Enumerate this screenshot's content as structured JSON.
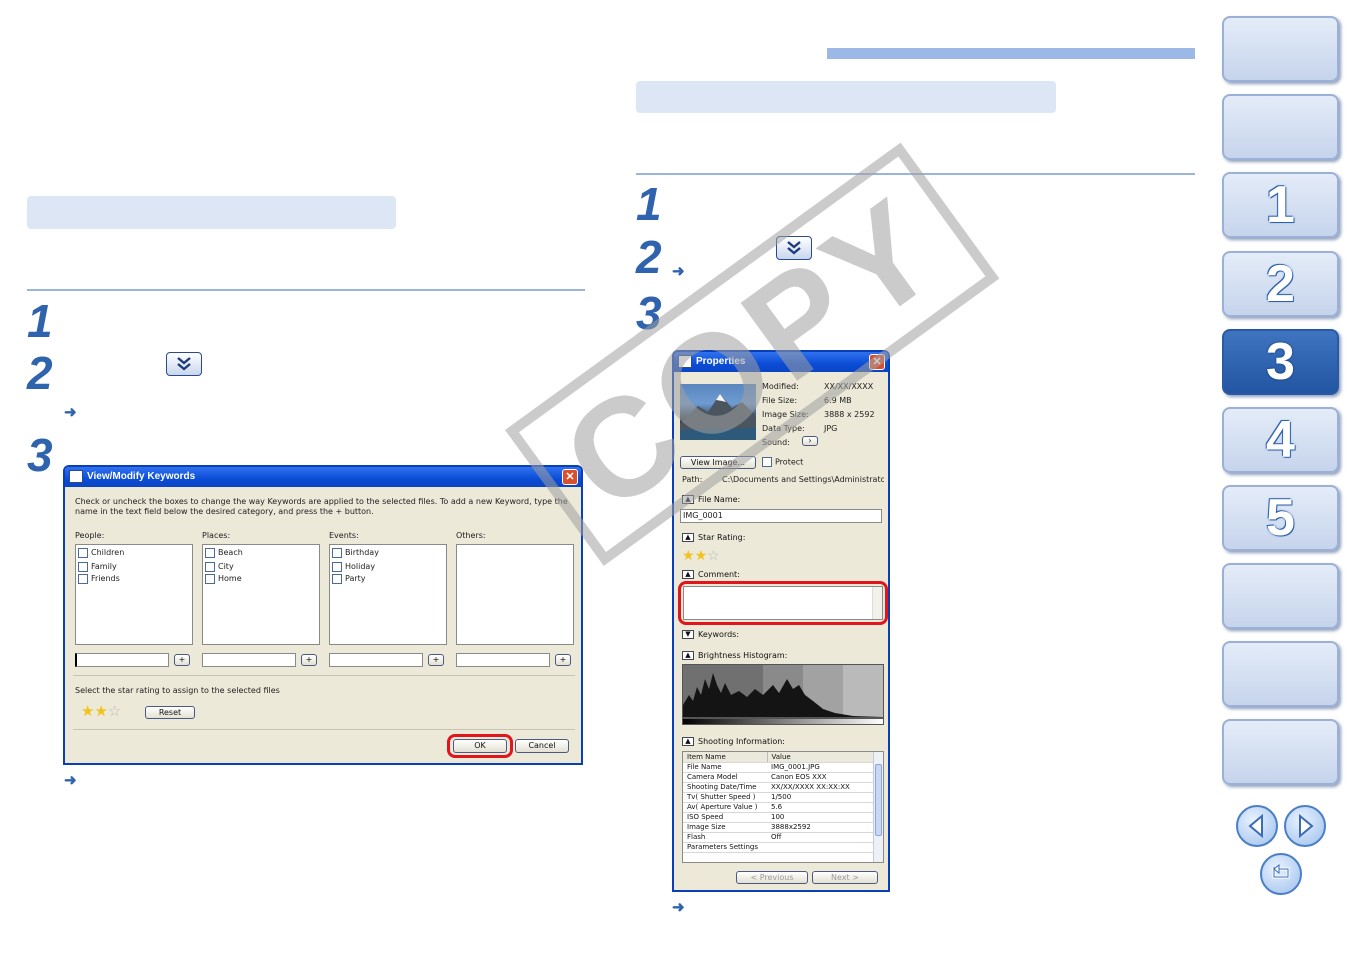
{
  "left_column": {
    "steps": [
      "1",
      "2",
      "3"
    ]
  },
  "right_column": {
    "steps": [
      "1",
      "2",
      "3"
    ]
  },
  "keywords_dialog": {
    "title": "View/Modify Keywords",
    "instruction": "Check or uncheck the boxes to change the way Keywords are applied to the selected files. To add a new Keyword, type the name in the text field below the desired category, and press the + button.",
    "columns": [
      {
        "label": "People:",
        "items": [
          "Children",
          "Family",
          "Friends"
        ]
      },
      {
        "label": "Places:",
        "items": [
          "Beach",
          "City",
          "Home"
        ]
      },
      {
        "label": "Events:",
        "items": [
          "Birthday",
          "Holiday",
          "Party"
        ]
      },
      {
        "label": "Others:",
        "items": []
      }
    ],
    "add_button": "+",
    "star_prompt": "Select the star rating to assign to the selected files",
    "rating": 2,
    "reset_label": "Reset",
    "ok_label": "OK",
    "cancel_label": "Cancel"
  },
  "properties_dialog": {
    "title": "Properties",
    "info": [
      {
        "label": "Modified:",
        "value": "XX/XX/XXXX"
      },
      {
        "label": "File Size:",
        "value": "6.9 MB"
      },
      {
        "label": "Image Size:",
        "value": "3888 x 2592"
      },
      {
        "label": "Data Type:",
        "value": "JPG"
      },
      {
        "label": "Sound:",
        "value": ""
      }
    ],
    "view_image_label": "View Image...",
    "protect_label": "Protect",
    "path_label": "Path:",
    "path_value": "C:\\Documents and Settings\\Administrator\\My",
    "file_name_label": "File Name:",
    "file_name_value": "IMG_0001",
    "star_rating_label": "Star Rating:",
    "rating": 2,
    "comment_label": "Comment:",
    "keywords_label": "Keywords:",
    "histogram_label": "Brightness Histogram:",
    "shooting_label": "Shooting Information:",
    "table_headers": [
      "Item Name",
      "Value"
    ],
    "table_rows": [
      [
        "File Name",
        "IMG_0001.JPG"
      ],
      [
        "Camera Model",
        "Canon EOS XXX"
      ],
      [
        "Shooting Date/Time",
        "XX/XX/XXXX XX:XX:XX"
      ],
      [
        "Tv( Shutter Speed )",
        "1/500"
      ],
      [
        "Av( Aperture Value )",
        "5.6"
      ],
      [
        "ISO Speed",
        "100"
      ],
      [
        "Image Size",
        "3888x2592"
      ],
      [
        "Flash",
        "Off"
      ],
      [
        "Parameters Settings",
        ""
      ]
    ],
    "previous_label": "< Previous",
    "next_label": "Next >"
  },
  "watermark": "COPY",
  "nav": {
    "chapters": [
      "",
      "",
      "1",
      "2",
      "3",
      "4",
      "5",
      "",
      "",
      ""
    ],
    "active_index": 4
  },
  "colors": {
    "accent": "#2f63ad",
    "label_box": "#dde6f5",
    "highlight": "#e2151c",
    "nav_active": "#2a5aa4"
  },
  "icons": [
    "expand-down-icon",
    "result-arrow-icon",
    "star-icon",
    "back-arrow-icon",
    "forward-arrow-icon",
    "return-icon"
  ]
}
